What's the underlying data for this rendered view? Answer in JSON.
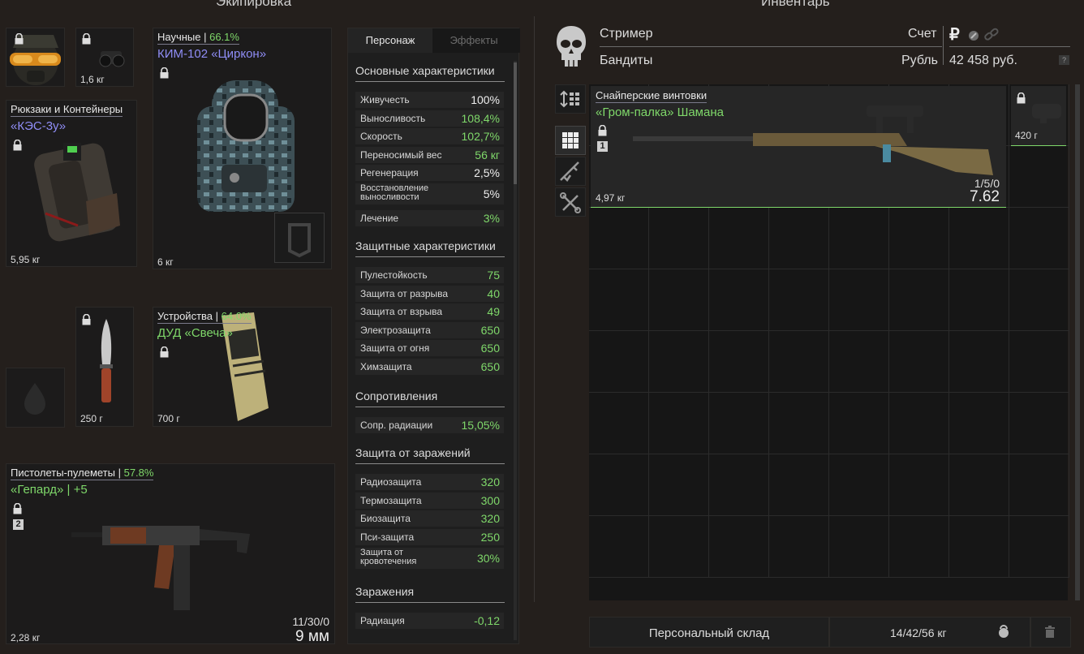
{
  "titles": {
    "equipment": "Экипировка",
    "inventory": "Инвентарь"
  },
  "equipment": {
    "helmet_slot": {
      "icon": "gas-mask-icon"
    },
    "nv_slot": {
      "weight": "1,6 кг",
      "icon": "night-vision-icon"
    },
    "backpack": {
      "category": "Рюкзаки и Контейнеры",
      "name": "«КЭС-3у»",
      "weight": "5,95 кг"
    },
    "suit": {
      "category": "Научные",
      "sep": " | ",
      "pct": "66.1%",
      "name": "КИМ-102 «Циркон»",
      "weight": "6 кг"
    },
    "knife": {
      "weight": "250 г"
    },
    "device": {
      "category": "Устройства",
      "sep": " | ",
      "pct": "64.0%",
      "name": "ДУД «Свеча»",
      "weight": "700 г"
    },
    "weapon": {
      "category": "Пистолеты-пулеметы",
      "sep": " | ",
      "pct": "57.8%",
      "name": "«Гепард» | +5",
      "badge": "2",
      "ammo": "11/30/0",
      "caliber": "9 мм",
      "weight": "2,28 кг"
    }
  },
  "stats_panel": {
    "tabs": [
      "Персонаж",
      "Эффекты"
    ],
    "sections": {
      "main": {
        "title": "Основные характеристики",
        "rows": [
          {
            "label": "Живучесть",
            "value": "100%",
            "color": "white"
          },
          {
            "label": "Выносливость",
            "value": "108,4%",
            "color": "green"
          },
          {
            "label": "Скорость",
            "value": "102,7%",
            "color": "green"
          },
          {
            "label": "Переносимый вес",
            "value": "56 кг",
            "color": "green"
          },
          {
            "label": "Регенерация",
            "value": "2,5%",
            "color": "white"
          },
          {
            "label": "Восстановление выносливости",
            "value": "5%",
            "color": "white"
          },
          {
            "label": "Лечение",
            "value": "3%",
            "color": "green"
          }
        ]
      },
      "protection": {
        "title": "Защитные характеристики",
        "rows": [
          {
            "label": "Пулестойкость",
            "value": "75"
          },
          {
            "label": "Защита от разрыва",
            "value": "40"
          },
          {
            "label": "Защита от взрыва",
            "value": "49"
          },
          {
            "label": "Электрозащита",
            "value": "650"
          },
          {
            "label": "Защита от огня",
            "value": "650"
          },
          {
            "label": "Химзащита",
            "value": "650"
          }
        ]
      },
      "resistances": {
        "title": "Сопротивления",
        "rows": [
          {
            "label": "Сопр. радиации",
            "value": "15,05%"
          }
        ]
      },
      "contamination_protection": {
        "title": "Защита от заражений",
        "rows": [
          {
            "label": "Радиозащита",
            "value": "320"
          },
          {
            "label": "Термозащита",
            "value": "300"
          },
          {
            "label": "Биозащита",
            "value": "320"
          },
          {
            "label": "Пси-защита",
            "value": "250"
          },
          {
            "label": "Защита от кровотечения",
            "value": "30%"
          }
        ]
      },
      "infections": {
        "title": "Заражения",
        "rows": [
          {
            "label": "Радиация",
            "value": "-0,12"
          }
        ]
      }
    }
  },
  "profile": {
    "name": "Стример",
    "faction": "Бандиты",
    "account_label": "Счет",
    "currency_label": "Рубль",
    "balance": "42 458 руб.",
    "help": "?"
  },
  "inventory": {
    "rifle": {
      "category": "Снайперские винтовки",
      "name": "«Гром-палка» Шамана",
      "badge": "1",
      "weight": "4,97 кг",
      "ammo": "1/5/0",
      "caliber": "7.62"
    },
    "scope": {
      "weight": "420 г"
    },
    "sidebar": [
      "sort-icon",
      "grid-icon",
      "rifle-filter-icon",
      "tools-icon"
    ]
  },
  "footer": {
    "stash": "Персональный склад",
    "weight": "14/42/56 кг"
  },
  "colors": {
    "accent_green": "#7fd86a",
    "accent_purple": "#8f8df5",
    "background": "#241f1c"
  }
}
